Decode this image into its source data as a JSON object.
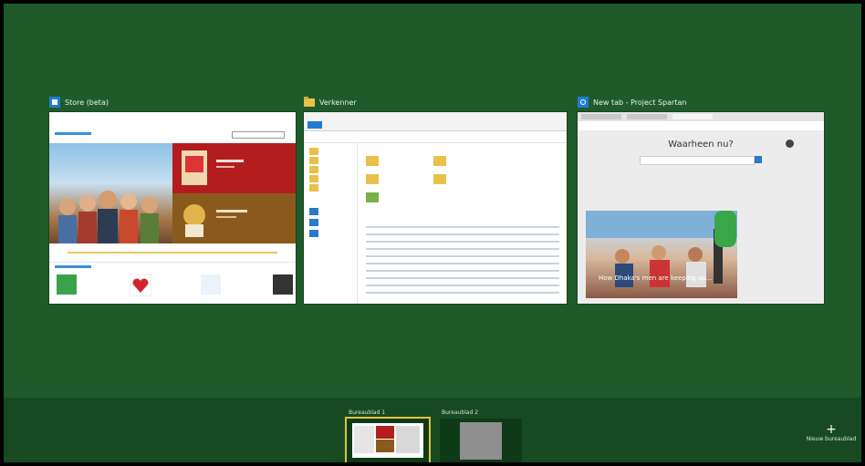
{
  "windows": [
    {
      "title": "Store (beta)",
      "icon": "store-icon",
      "accent": "#1e7cd4"
    },
    {
      "title": "Verkenner",
      "icon": "folder-icon",
      "accent": "#e9c14a"
    },
    {
      "title": "New tab - Project Spartan",
      "icon": "browser-icon",
      "accent": "#1e7cd4"
    }
  ],
  "edge": {
    "heading": "Waarheen nu?",
    "caption": "How Dhaka's men are keeping up..."
  },
  "desktops": [
    {
      "label": "Bureaublad 1",
      "active": true
    },
    {
      "label": "Bureaublad 2",
      "active": false
    }
  ],
  "new_desktop": {
    "label": "Nieuw bureaublad",
    "icon": "plus-icon"
  },
  "colors": {
    "background": "#1f5b2a",
    "bar": "#174a21",
    "active_outline": "#e0c43a"
  }
}
